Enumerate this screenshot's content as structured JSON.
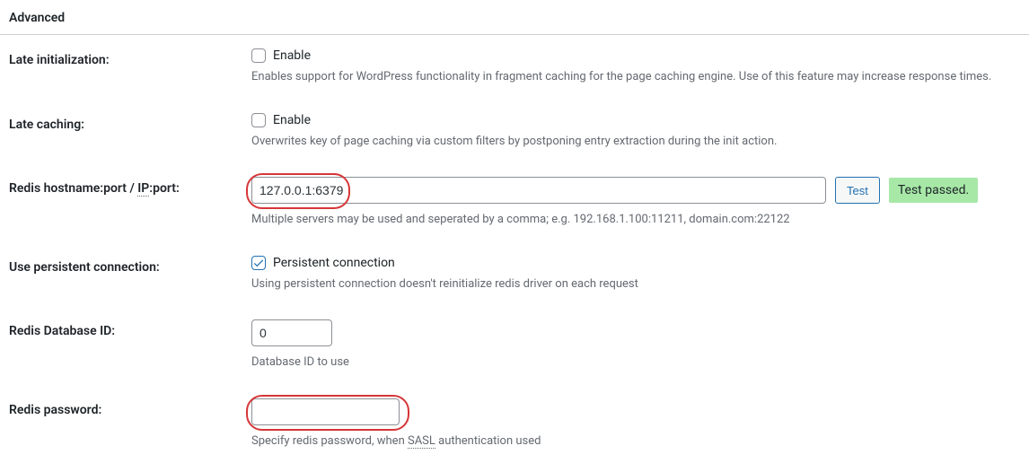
{
  "section": {
    "title": "Advanced"
  },
  "late_init": {
    "label": "Late initialization:",
    "checkbox_label": "Enable",
    "description": "Enables support for WordPress functionality in fragment caching for the page caching engine. Use of this feature may increase response times."
  },
  "late_caching": {
    "label": "Late caching:",
    "checkbox_label": "Enable",
    "description": "Overwrites key of page caching via custom filters by postponing entry extraction during the init action."
  },
  "redis_host": {
    "label_part1": "Redis hostname:port / ",
    "label_ip": "IP",
    "label_part2": ":port:",
    "value": "127.0.0.1:6379",
    "test_button": "Test",
    "test_result": "Test passed.",
    "description": "Multiple servers may be used and seperated by a comma; e.g. 192.168.1.100:11211, domain.com:22122"
  },
  "persistent": {
    "label": "Use persistent connection:",
    "checkbox_label": "Persistent connection",
    "description": "Using persistent connection doesn't reinitialize redis driver on each request"
  },
  "db_id": {
    "label": "Redis Database ID:",
    "value": "0",
    "description": "Database ID to use"
  },
  "password": {
    "label": "Redis password:",
    "value": "",
    "description_part1": "Specify redis password, when ",
    "description_sasl": "SASL",
    "description_part2": " authentication used"
  }
}
